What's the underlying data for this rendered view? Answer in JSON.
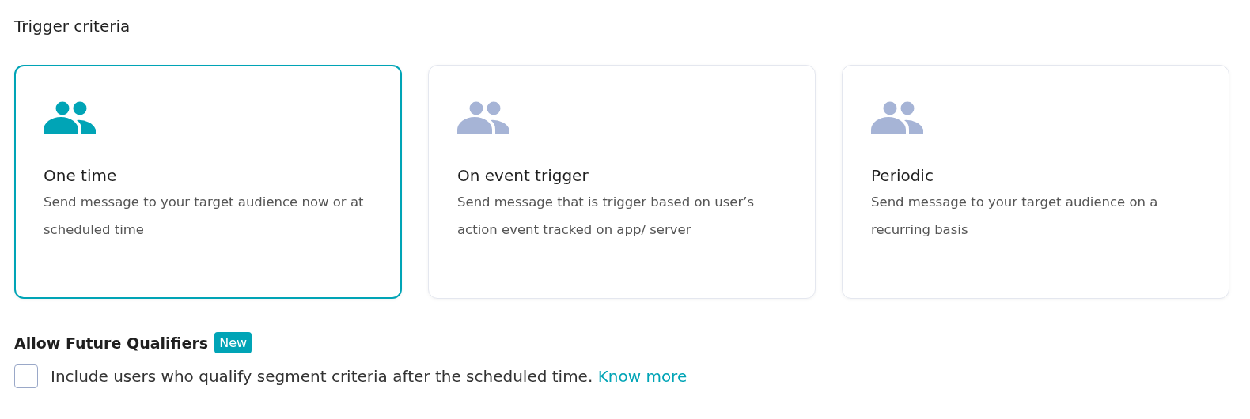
{
  "section_title": "Trigger criteria",
  "options": [
    {
      "title": "One time",
      "description": "Send message to your target audience now or at scheduled time",
      "selected": true
    },
    {
      "title": "On event trigger",
      "description": "Send message that is trigger based on user’s action event tracked on app/ server",
      "selected": false
    },
    {
      "title": "Periodic",
      "description": "Send message to your target audience on a recurring basis",
      "selected": false
    }
  ],
  "qualifiers": {
    "title": "Allow Future Qualifiers",
    "badge": "New",
    "checkbox": {
      "label": "Include users who qualify segment criteria after the scheduled time.",
      "checked": false,
      "link": "Know more"
    }
  }
}
